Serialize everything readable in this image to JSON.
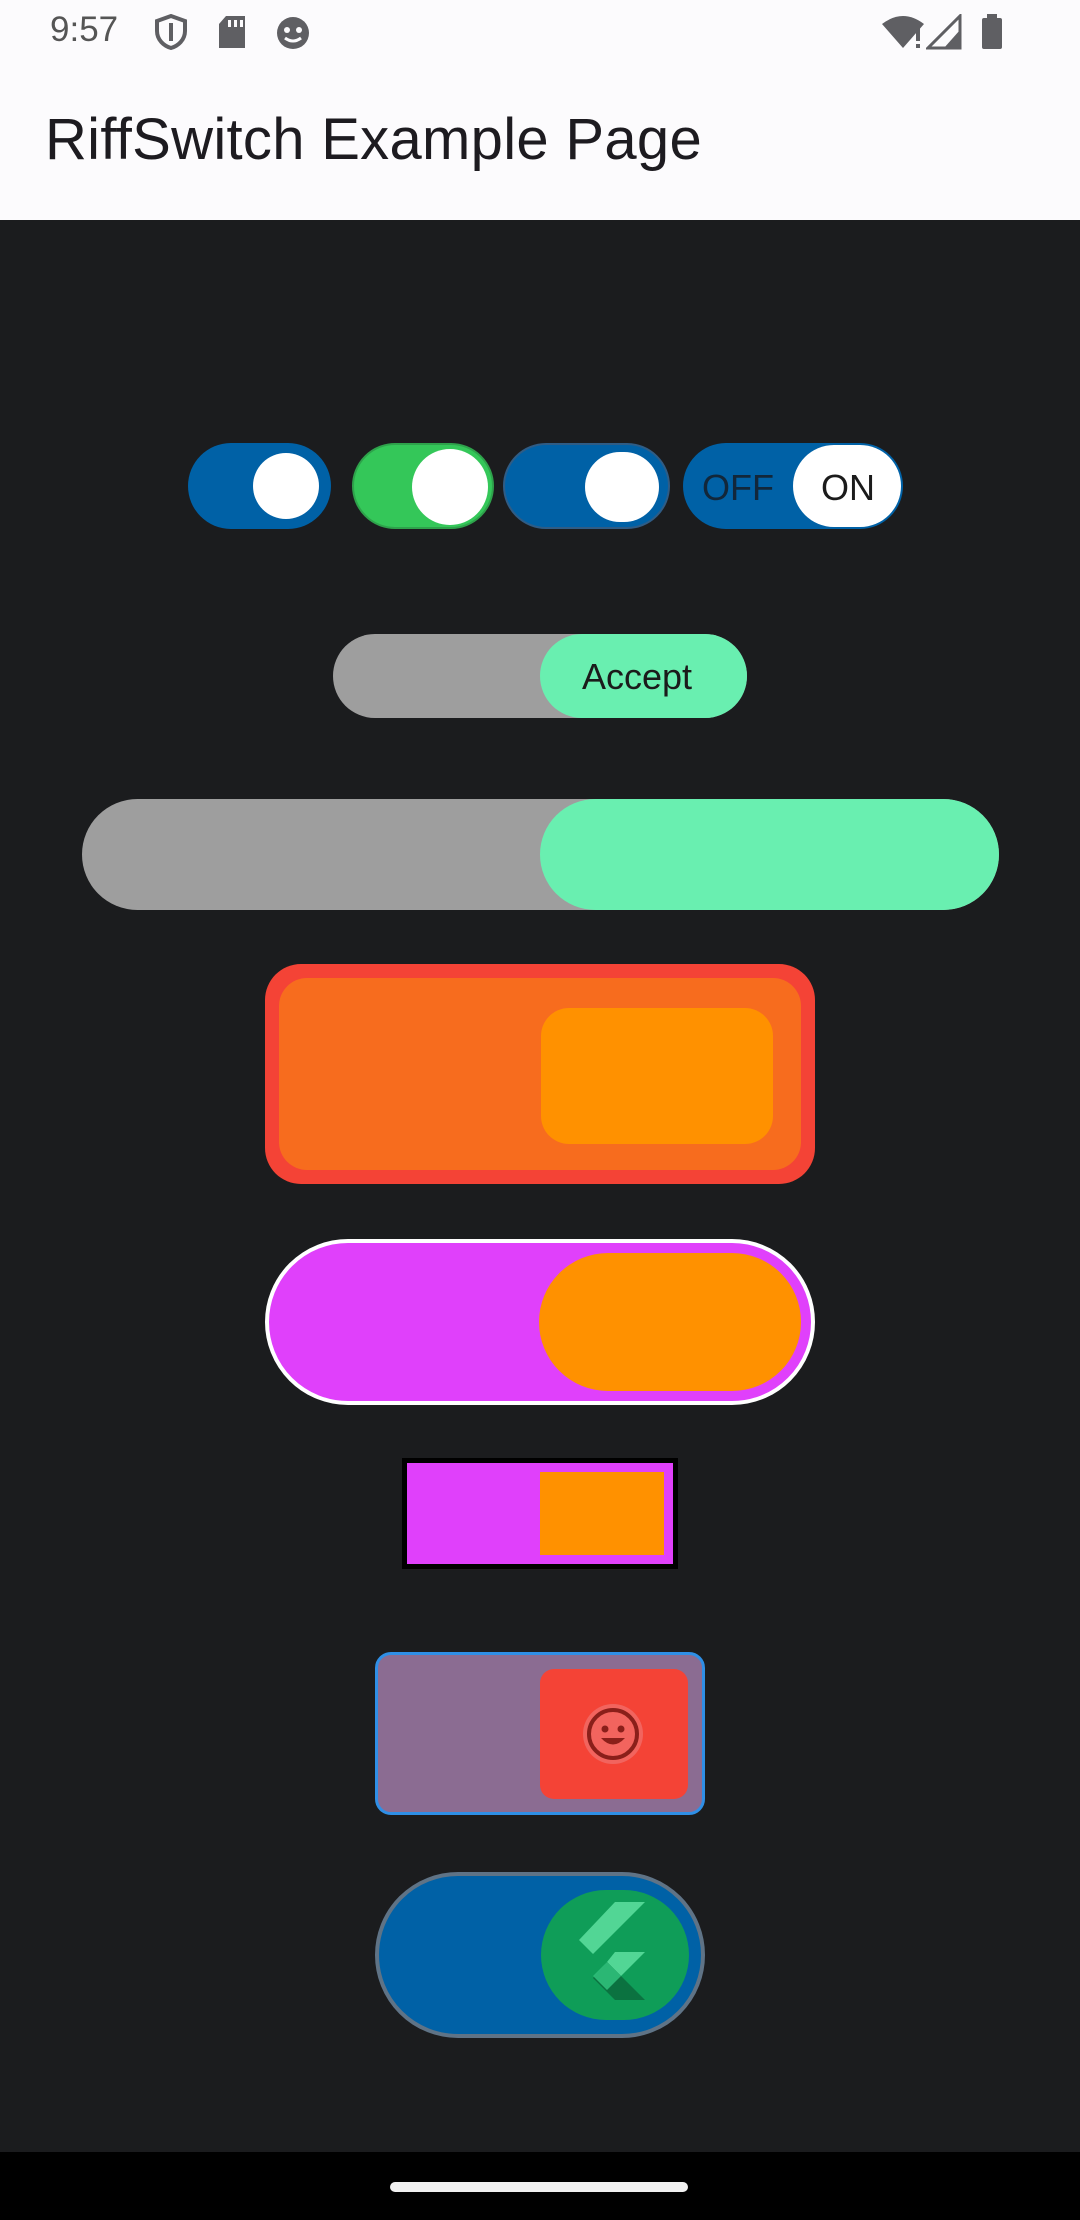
{
  "status_bar": {
    "time": "9:57",
    "left_icons": [
      "shield-icon",
      "sd-card-icon",
      "android-debug-icon"
    ],
    "right_icons": [
      "wifi-alert-icon",
      "cell-signal-icon",
      "battery-icon"
    ]
  },
  "app_bar": {
    "title": "RiffSwitch Example Page"
  },
  "switches": {
    "row": {
      "s1_state": "on",
      "s2_state": "on",
      "s3_state": "on",
      "labeled": {
        "off_label": "OFF",
        "on_label": "ON",
        "state": "on"
      }
    },
    "accept": {
      "label": "Accept",
      "state": "on"
    },
    "colors": {
      "blue": "#0061a6",
      "green": "#34c759",
      "mint": "#69efb0",
      "grey": "#9e9e9e",
      "orange_track": "#f76c1e",
      "orange_thumb": "#ff9100",
      "red_border": "#f44336",
      "magenta": "#e040fb",
      "mauve": "#8b6c92"
    },
    "emoji_switch": {
      "thumb_icon": "smiley-face-icon"
    },
    "flutter_switch": {
      "thumb_icon": "flutter-logo-icon"
    }
  }
}
